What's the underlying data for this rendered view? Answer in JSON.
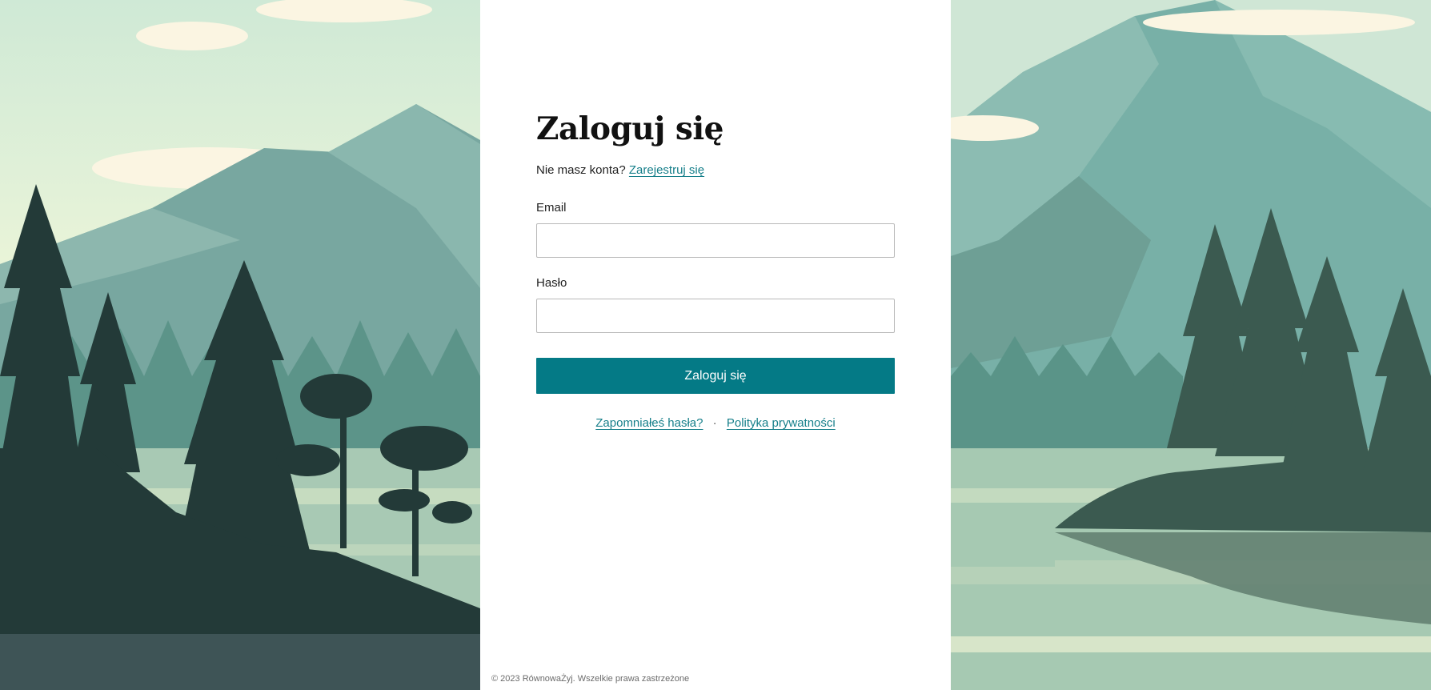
{
  "login": {
    "title": "Zaloguj się",
    "no_account_text": "Nie masz konta?",
    "register_link": "Zarejestruj się",
    "email_label": "Email",
    "email_value": "",
    "password_label": "Hasło",
    "password_value": "",
    "submit_label": "Zaloguj się",
    "forgot_password_link": "Zapomniałeś hasła?",
    "separator": "·",
    "privacy_link": "Polityka prywatności"
  },
  "footer": {
    "copyright": "© 2023 RównowaŻyj. Wszelkie prawa zastrzeżone"
  },
  "colors": {
    "accent": "#047a86",
    "link": "#167f8a",
    "panel_background": "#ffffff",
    "forest_dark": "#233a38",
    "mountain": "#76aca4",
    "sky": "#e6f3d6",
    "lake": "#a9cdb8"
  }
}
